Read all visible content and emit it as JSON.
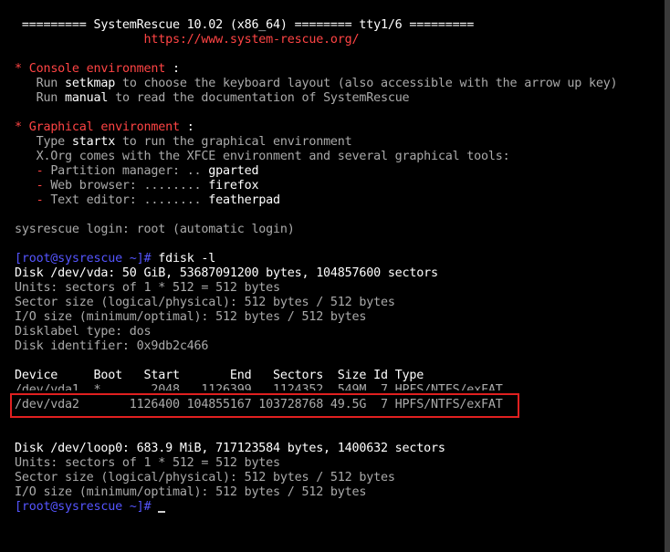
{
  "header": {
    "banner": " ========= SystemRescue 10.02 (x86_64) ======== tty1/6 =========",
    "url": "                  https://www.system-rescue.org/"
  },
  "console_env": {
    "bullet": "*",
    "title": " Console environment",
    "colon": " :",
    "l1_prefix": "   Run ",
    "l1_cmd": "setkmap",
    "l1_suffix": " to choose the keyboard layout (also accessible with the arrow up key)",
    "l2_prefix": "   Run ",
    "l2_cmd": "manual",
    "l2_suffix": " to read the documentation of SystemRescue"
  },
  "graphical_env": {
    "bullet": "*",
    "title": " Graphical environment",
    "colon": " :",
    "l1_prefix": "   Type ",
    "l1_cmd": "startx",
    "l1_suffix": " to run the graphical environment",
    "l2": "   X.Org comes with the XFCE environment and several graphical tools:",
    "tools": [
      {
        "dash": "   -",
        "label": " Partition manager: .. ",
        "value": "gparted"
      },
      {
        "dash": "   -",
        "label": " Web browser: ........ ",
        "value": "firefox"
      },
      {
        "dash": "   -",
        "label": " Text editor: ........ ",
        "value": "featherpad"
      }
    ]
  },
  "login_line": "sysrescue login: root (automatic login)",
  "prompt": "[root@sysrescue ~]#",
  "command1": " fdisk -l",
  "disk_vda": {
    "title": "Disk /dev/vda: 50 GiB, 53687091200 bytes, 104857600 sectors",
    "units": "Units: sectors of 1 * 512 = 512 bytes",
    "sector_size": "Sector size (logical/physical): 512 bytes / 512 bytes",
    "io_size": "I/O size (minimum/optimal): 512 bytes / 512 bytes",
    "label_type": "Disklabel type: dos",
    "identifier": "Disk identifier: 0x9db2c466"
  },
  "partition_table": {
    "header": "Device     Boot   Start       End   Sectors  Size Id Type",
    "rows": [
      "/dev/vda1  *       2048   1126399   1124352  549M  7 HPFS/NTFS/exFAT",
      "/dev/vda2       1126400 104855167 103728768 49.5G  7 HPFS/NTFS/exFAT"
    ]
  },
  "disk_loop0": {
    "title": "Disk /dev/loop0: 683.9 MiB, 717123584 bytes, 1400632 sectors",
    "units": "Units: sectors of 1 * 512 = 512 bytes",
    "sector_size": "Sector size (logical/physical): 512 bytes / 512 bytes",
    "io_size": "I/O size (minimum/optimal): 512 bytes / 512 bytes"
  },
  "colors": {
    "background": "#000000",
    "text_normal": "#aaaaaa",
    "text_bright": "#ffffff",
    "accent_red": "#ff4444",
    "prompt_blue": "#5555ff",
    "highlight_box": "#e02020"
  }
}
